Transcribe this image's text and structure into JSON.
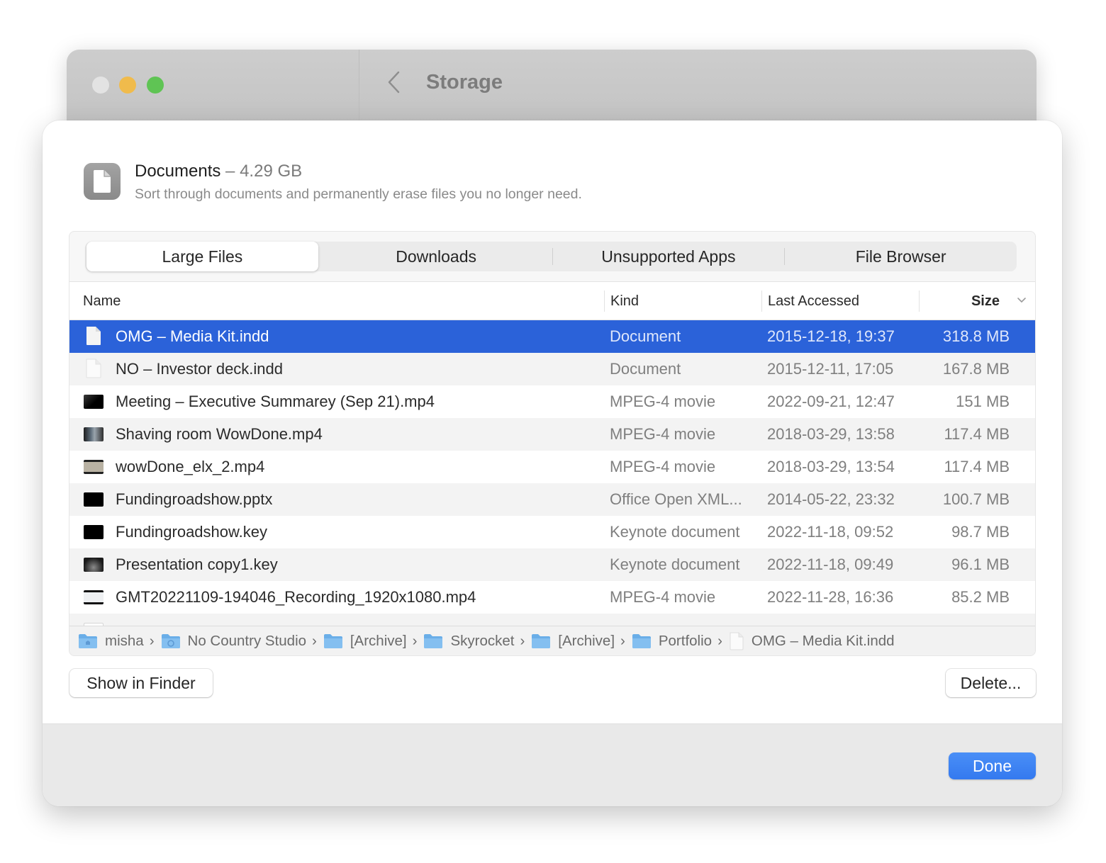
{
  "window": {
    "title": "Storage",
    "back_icon": "chevron-left-icon"
  },
  "header": {
    "icon": "document-icon",
    "category": "Documents",
    "separator": " – ",
    "total_size": "4.29 GB",
    "description": "Sort through documents and permanently erase files you no longer need."
  },
  "tabs": [
    {
      "label": "Large Files",
      "active": true
    },
    {
      "label": "Downloads",
      "active": false
    },
    {
      "label": "Unsupported Apps",
      "active": false
    },
    {
      "label": "File Browser",
      "active": false
    }
  ],
  "table": {
    "columns": {
      "name": "Name",
      "kind": "Kind",
      "last_accessed": "Last Accessed",
      "size": "Size"
    },
    "sort": {
      "column": "Size",
      "direction": "descending"
    },
    "rows": [
      {
        "name": "OMG – Media Kit.indd",
        "kind": "Document",
        "last_accessed": "2015-12-18, 19:37",
        "size": "318.8 MB",
        "icon": "blank-document-icon",
        "selected": true
      },
      {
        "name": "NO – Investor deck.indd",
        "kind": "Document",
        "last_accessed": "2015-12-11, 17:05",
        "size": "167.8 MB",
        "icon": "blank-document-icon",
        "selected": false
      },
      {
        "name": "Meeting – Executive Summarey (Sep 21).mp4",
        "kind": "MPEG-4 movie",
        "last_accessed": "2022-09-21, 12:47",
        "size": "151 MB",
        "icon": "video-thumbnail-icon",
        "selected": false
      },
      {
        "name": "Shaving room WowDone.mp4",
        "kind": "MPEG-4 movie",
        "last_accessed": "2018-03-29, 13:58",
        "size": "117.4 MB",
        "icon": "video-thumbnail-icon",
        "selected": false
      },
      {
        "name": "wowDone_elx_2.mp4",
        "kind": "MPEG-4 movie",
        "last_accessed": "2018-03-29, 13:54",
        "size": "117.4 MB",
        "icon": "video-thumbnail-icon",
        "selected": false
      },
      {
        "name": "Fundingroadshow.pptx",
        "kind": "Office Open XML...",
        "last_accessed": "2014-05-22, 23:32",
        "size": "100.7 MB",
        "icon": "presentation-thumbnail-icon",
        "selected": false
      },
      {
        "name": "Fundingroadshow.key",
        "kind": "Keynote document",
        "last_accessed": "2022-11-18, 09:52",
        "size": "98.7 MB",
        "icon": "presentation-thumbnail-icon",
        "selected": false
      },
      {
        "name": "Presentation copy1.key",
        "kind": "Keynote document",
        "last_accessed": "2022-11-18, 09:49",
        "size": "96.1 MB",
        "icon": "presentation-thumbnail-icon",
        "selected": false
      },
      {
        "name": "GMT20221109-194046_Recording_1920x1080.mp4",
        "kind": "MPEG-4 movie",
        "last_accessed": "2022-11-28, 16:36",
        "size": "85.2 MB",
        "icon": "video-thumbnail-icon",
        "selected": false
      }
    ]
  },
  "path_bar": [
    {
      "label": "misha",
      "icon": "home-folder-icon"
    },
    {
      "label": "No Country Studio",
      "icon": "shared-folder-icon"
    },
    {
      "label": "[Archive]",
      "icon": "folder-icon"
    },
    {
      "label": "Skyrocket",
      "icon": "folder-icon"
    },
    {
      "label": "[Archive]",
      "icon": "folder-icon"
    },
    {
      "label": "Portfolio",
      "icon": "folder-icon"
    },
    {
      "label": "OMG – Media Kit.indd",
      "icon": "blank-document-icon"
    }
  ],
  "path_separator": "›",
  "buttons": {
    "show_in_finder": "Show in Finder",
    "delete": "Delete...",
    "done": "Done"
  },
  "colors": {
    "accent": "#2b62d9",
    "done_button": "#3a80f2",
    "traffic_close": "#e3e3e3",
    "traffic_minimize": "#f0bb4c",
    "traffic_maximize": "#5fc454",
    "folder": "#6aaee8"
  }
}
